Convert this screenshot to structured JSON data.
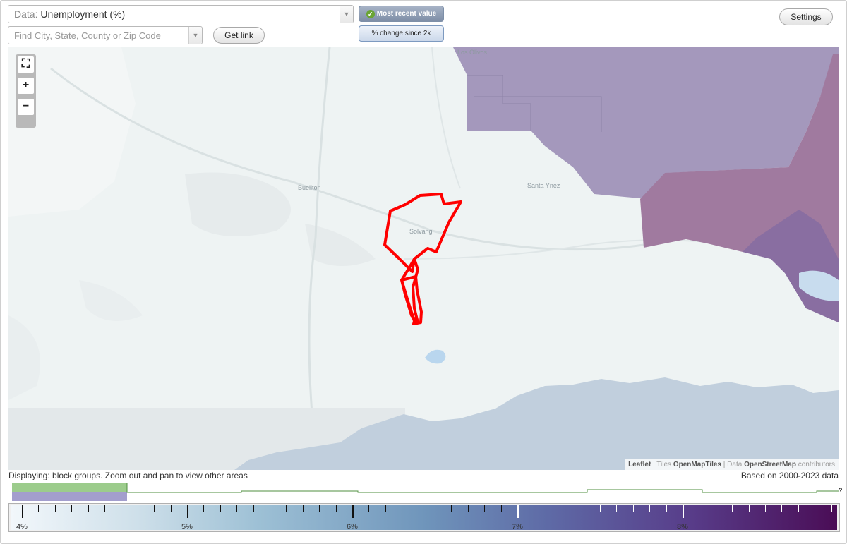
{
  "header": {
    "data_prefix": "Data:",
    "data_value": "Unemployment (%)",
    "find_placeholder": "Find City, State, County or Zip Code",
    "get_link": "Get link",
    "mode_active": "Most recent value",
    "mode_inactive": "% change since 2k",
    "settings": "Settings"
  },
  "map": {
    "zoom_in": "+",
    "zoom_out": "−",
    "places": [
      "Los Olivos",
      "Buellton",
      "Santa Ynez",
      "Solvang"
    ],
    "attribution": {
      "leaflet": "Leaflet",
      "tiles_label": "Tiles",
      "tiles": "OpenMapTiles",
      "data_label": "Data",
      "data": "OpenStreetMap",
      "contributors": "contributors"
    },
    "colors": {
      "background": "#eef3f3",
      "highlight_outline": "#ff0000",
      "purple_region": "#a498bc",
      "magenta_region": "#a07a9f",
      "gray_region": "#c1cfdd"
    }
  },
  "footer": {
    "displaying": "Displaying: block groups. Zoom out and pan to view other areas",
    "based_on": "Based on 2000-2023 data",
    "help": "?",
    "legend_labels": [
      "4%",
      "5%",
      "6%",
      "7%",
      "8%"
    ],
    "legend_min": 4,
    "legend_max": 9
  }
}
